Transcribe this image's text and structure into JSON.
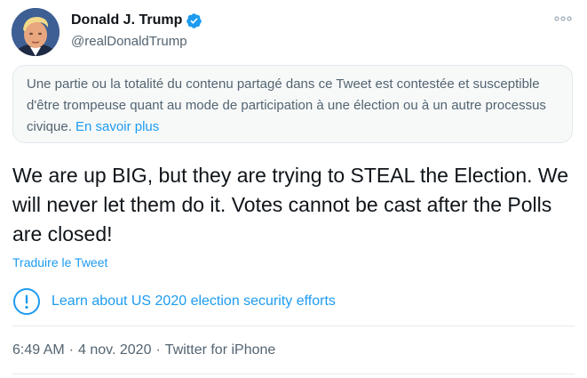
{
  "author": {
    "name": "Donald J. Trump",
    "handle": "@realDonaldTrump",
    "verified": true,
    "avatar_icon": "profile-photo"
  },
  "notice": {
    "text": "Une partie ou la totalité du contenu partagé dans ce Tweet est contestée et susceptible d'être trompeuse quant au mode de participation à une élection ou à un autre processus civique.",
    "link": "En savoir plus"
  },
  "tweet": {
    "text": "We are up BIG, but they are trying to STEAL the Election. We will never let them do it. Votes cannot be cast after the Polls are closed!",
    "translate": "Traduire le Tweet"
  },
  "learn": {
    "label": "Learn about US 2020 election security efforts",
    "icon": "exclamation-circle-icon"
  },
  "meta": {
    "time": "6:49 AM",
    "separator": "·",
    "date": "4 nov. 2020",
    "source": "Twitter for iPhone"
  },
  "colors": {
    "accent": "#1d9bf0",
    "secondary_text": "#536471",
    "notice_bg": "#f7f9f9"
  }
}
